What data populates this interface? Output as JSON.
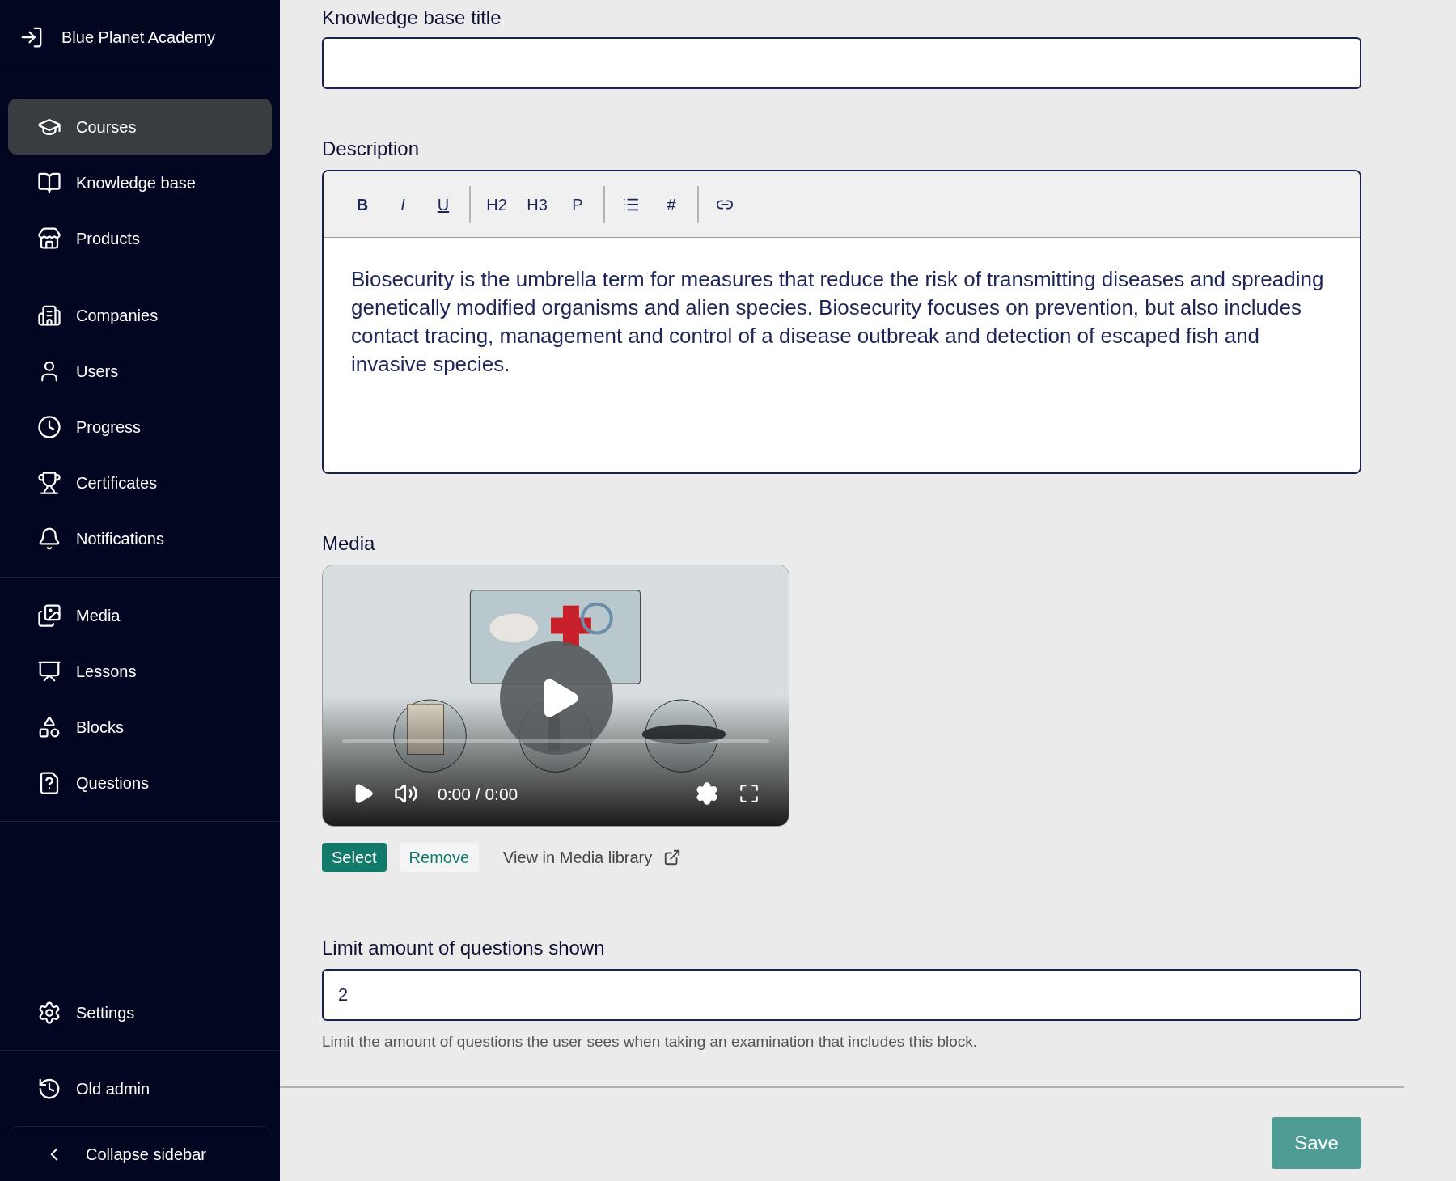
{
  "sidebar": {
    "brand": "Blue Planet Academy",
    "groups": [
      [
        {
          "label": "Courses",
          "selected": true
        },
        {
          "label": "Knowledge base",
          "selected": false
        },
        {
          "label": "Products",
          "selected": false
        }
      ],
      [
        {
          "label": "Companies",
          "selected": false
        },
        {
          "label": "Users",
          "selected": false
        },
        {
          "label": "Progress",
          "selected": false
        },
        {
          "label": "Certificates",
          "selected": false
        },
        {
          "label": "Notifications",
          "selected": false
        }
      ],
      [
        {
          "label": "Media",
          "selected": false
        },
        {
          "label": "Lessons",
          "selected": false
        },
        {
          "label": "Blocks",
          "selected": false
        },
        {
          "label": "Questions",
          "selected": false
        }
      ]
    ],
    "bottom_groups": [
      [
        {
          "label": "Settings",
          "selected": false
        }
      ],
      [
        {
          "label": "Old admin",
          "selected": false
        }
      ]
    ],
    "collapse": "Collapse sidebar"
  },
  "form": {
    "title_field": {
      "label": "Knowledge base title"
    },
    "description": {
      "label": "Description",
      "toolbar": [
        [
          {
            "kind": "bold",
            "label": "B"
          },
          {
            "kind": "italic",
            "label": "I"
          },
          {
            "kind": "underline",
            "label": "U"
          }
        ],
        [
          {
            "kind": "plain",
            "label": "H2"
          },
          {
            "kind": "plain",
            "label": "H3"
          },
          {
            "kind": "plain",
            "label": "P"
          }
        ],
        [
          {
            "kind": "list"
          },
          {
            "kind": "plain",
            "label": "#"
          }
        ],
        [
          {
            "kind": "link"
          }
        ]
      ],
      "text": "Biosecurity is the umbrella term for measures that reduce the risk of transmitting diseases and spreading genetically modified organisms and alien species. Biosecurity focuses on prevention, but also includes contact tracing, management and control of a disease outbreak and detection of escaped fish and invasive species."
    },
    "media": {
      "label": "Media",
      "player": {
        "kind": "picture",
        "time": "0:00 / 0:00"
      },
      "actions": {
        "select": "Select",
        "remove": "Remove",
        "view": "View in Media library"
      }
    },
    "limit": {
      "label": "Limit amount of questions shown",
      "value": "2",
      "help": "Limit the amount of questions the user sees when taking an examination that includes this block."
    },
    "save": "Save"
  }
}
